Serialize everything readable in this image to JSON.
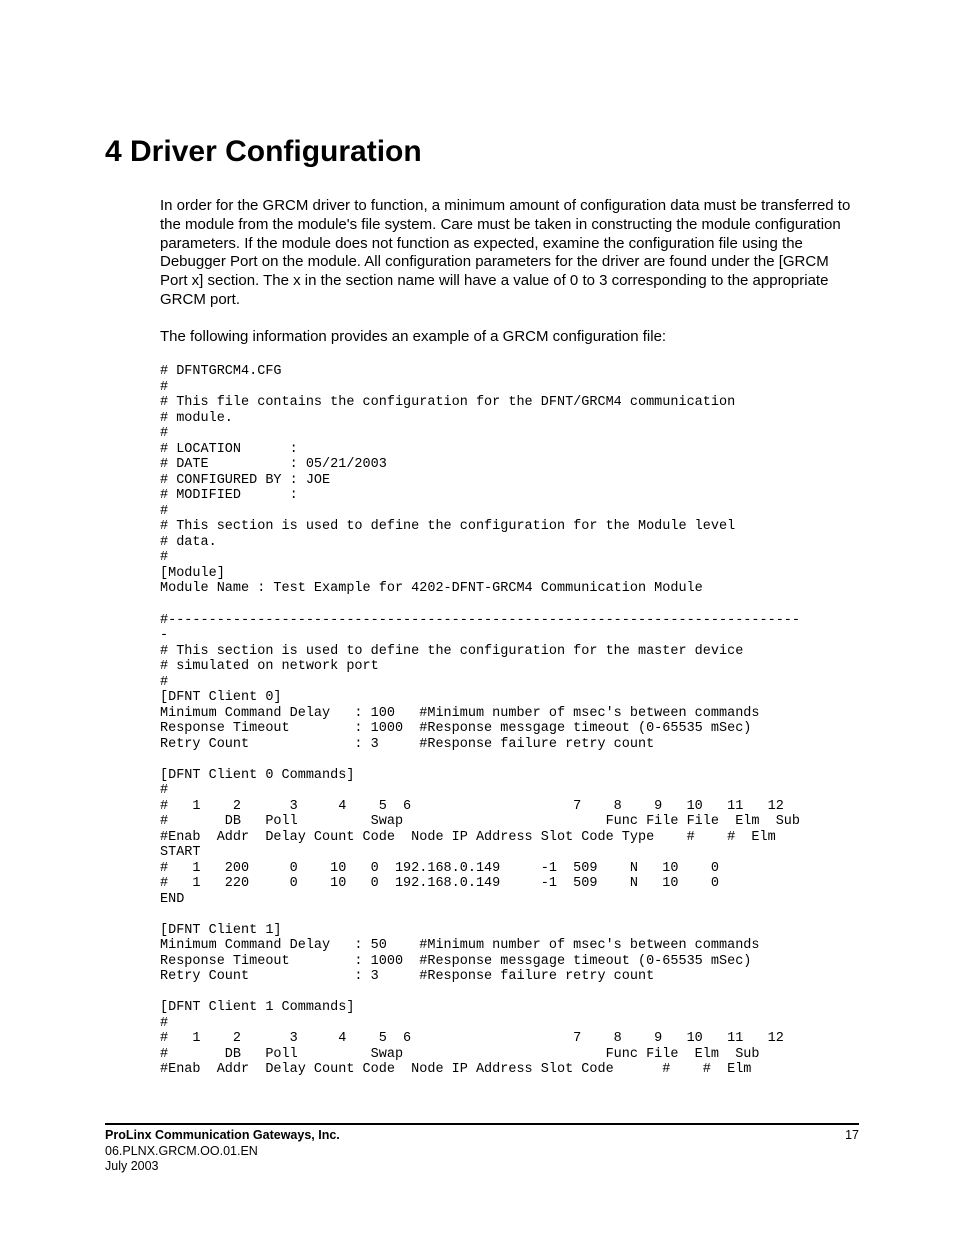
{
  "heading": "4  Driver Configuration",
  "para1": "In order for the GRCM driver to function, a minimum amount of configuration data must be transferred to the module from the module's file system.  Care must be taken in constructing the module configuration parameters.  If the module does not function as expected, examine the configuration file using the Debugger Port on the module.  All configuration parameters for the driver are found under the [GRCM Port x] section.  The x in the section name will have a value of 0 to 3 corresponding to the appropriate GRCM port.",
  "para2": "The following information provides an example of a GRCM configuration file:",
  "config": "# DFNTGRCM4.CFG\n#\n# This file contains the configuration for the DFNT/GRCM4 communication\n# module.\n#\n# LOCATION      :\n# DATE          : 05/21/2003\n# CONFIGURED BY : JOE\n# MODIFIED      :\n#\n# This section is used to define the configuration for the Module level\n# data.\n#\n[Module]\nModule Name : Test Example for 4202-DFNT-GRCM4 Communication Module\n\n#------------------------------------------------------------------------------\n-\n# This section is used to define the configuration for the master device\n# simulated on network port\n#\n[DFNT Client 0]\nMinimum Command Delay   : 100   #Minimum number of msec's between commands\nResponse Timeout        : 1000  #Response messgage timeout (0-65535 mSec)\nRetry Count             : 3     #Response failure retry count\n\n[DFNT Client 0 Commands]\n#\n#   1    2      3     4    5  6                    7    8    9   10   11   12\n#       DB   Poll         Swap                         Func File File  Elm  Sub\n#Enab  Addr  Delay Count Code  Node IP Address Slot Code Type    #    #  Elm\nSTART\n#   1   200     0    10   0  192.168.0.149     -1  509    N   10    0\n#   1   220     0    10   0  192.168.0.149     -1  509    N   10    0\nEND\n\n[DFNT Client 1]\nMinimum Command Delay   : 50    #Minimum number of msec's between commands\nResponse Timeout        : 1000  #Response messgage timeout (0-65535 mSec)\nRetry Count             : 3     #Response failure retry count\n\n[DFNT Client 1 Commands]\n#\n#   1    2      3     4    5  6                    7    8    9   10   11   12\n#       DB   Poll         Swap                         Func File  Elm  Sub\n#Enab  Addr  Delay Count Code  Node IP Address Slot Code      #    #  Elm",
  "footer": {
    "company": "ProLinx Communication Gateways, Inc.",
    "doc": "06.PLNX.GRCM.OO.01.EN",
    "date": "July 2003",
    "page": "17"
  }
}
